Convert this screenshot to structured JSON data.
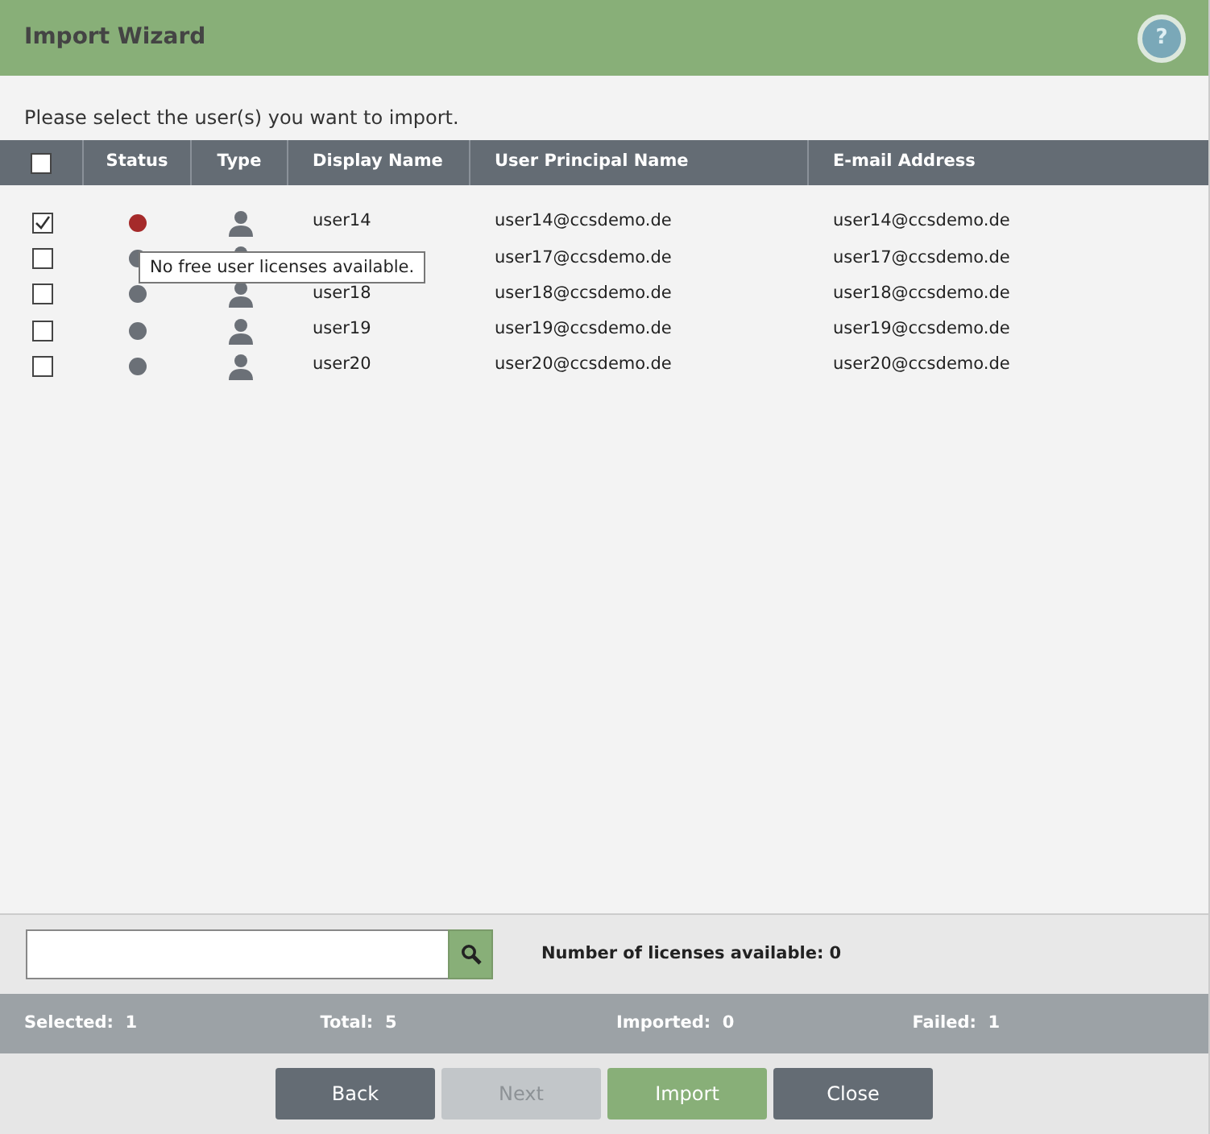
{
  "window": {
    "title": "Import Wizard",
    "help": "?"
  },
  "instruction": "Please select the user(s) you want to import.",
  "table": {
    "select_all": {
      "checked": false
    },
    "columns": [
      "Status",
      "Type",
      "Display Name",
      "User Principal Name",
      "E-mail Address"
    ],
    "rows": [
      {
        "checked": true,
        "color": "#a52a2a",
        "display_name": "user14",
        "upn": "user14@ccsdemo.de",
        "email": "user14@ccsdemo.de"
      },
      {
        "checked": false,
        "color": "#6b7077",
        "upn": "user17@ccsdemo.de",
        "email": "user17@ccsdemo.de"
      },
      {
        "checked": false,
        "color": "#6b7077",
        "display_name": "user18",
        "upn": "user18@ccsdemo.de",
        "email": "user18@ccsdemo.de"
      },
      {
        "checked": false,
        "color": "#6b7077",
        "display_name": "user19",
        "upn": "user19@ccsdemo.de",
        "email": "user19@ccsdemo.de"
      },
      {
        "checked": false,
        "color": "#6b7077",
        "display_name": "user20",
        "upn": "user20@ccsdemo.de",
        "email": "user20@ccsdemo.de"
      }
    ]
  },
  "tooltip": "No free user licenses available.",
  "licenses": "Number of licenses available: 0",
  "stats": [
    {
      "label": "Selected:",
      "value": "1"
    },
    {
      "label": "Total:",
      "value": "5"
    },
    {
      "label": "Imported:",
      "value": "0"
    },
    {
      "label": "Failed:",
      "value": "1"
    }
  ],
  "buttons": [
    {
      "label": "Back",
      "kind": "dark",
      "disabled": false
    },
    {
      "label": "Next",
      "kind": "dark",
      "disabled": true
    },
    {
      "label": "Import",
      "kind": "green",
      "disabled": false
    },
    {
      "label": "Close",
      "kind": "dark",
      "disabled": false
    }
  ]
}
